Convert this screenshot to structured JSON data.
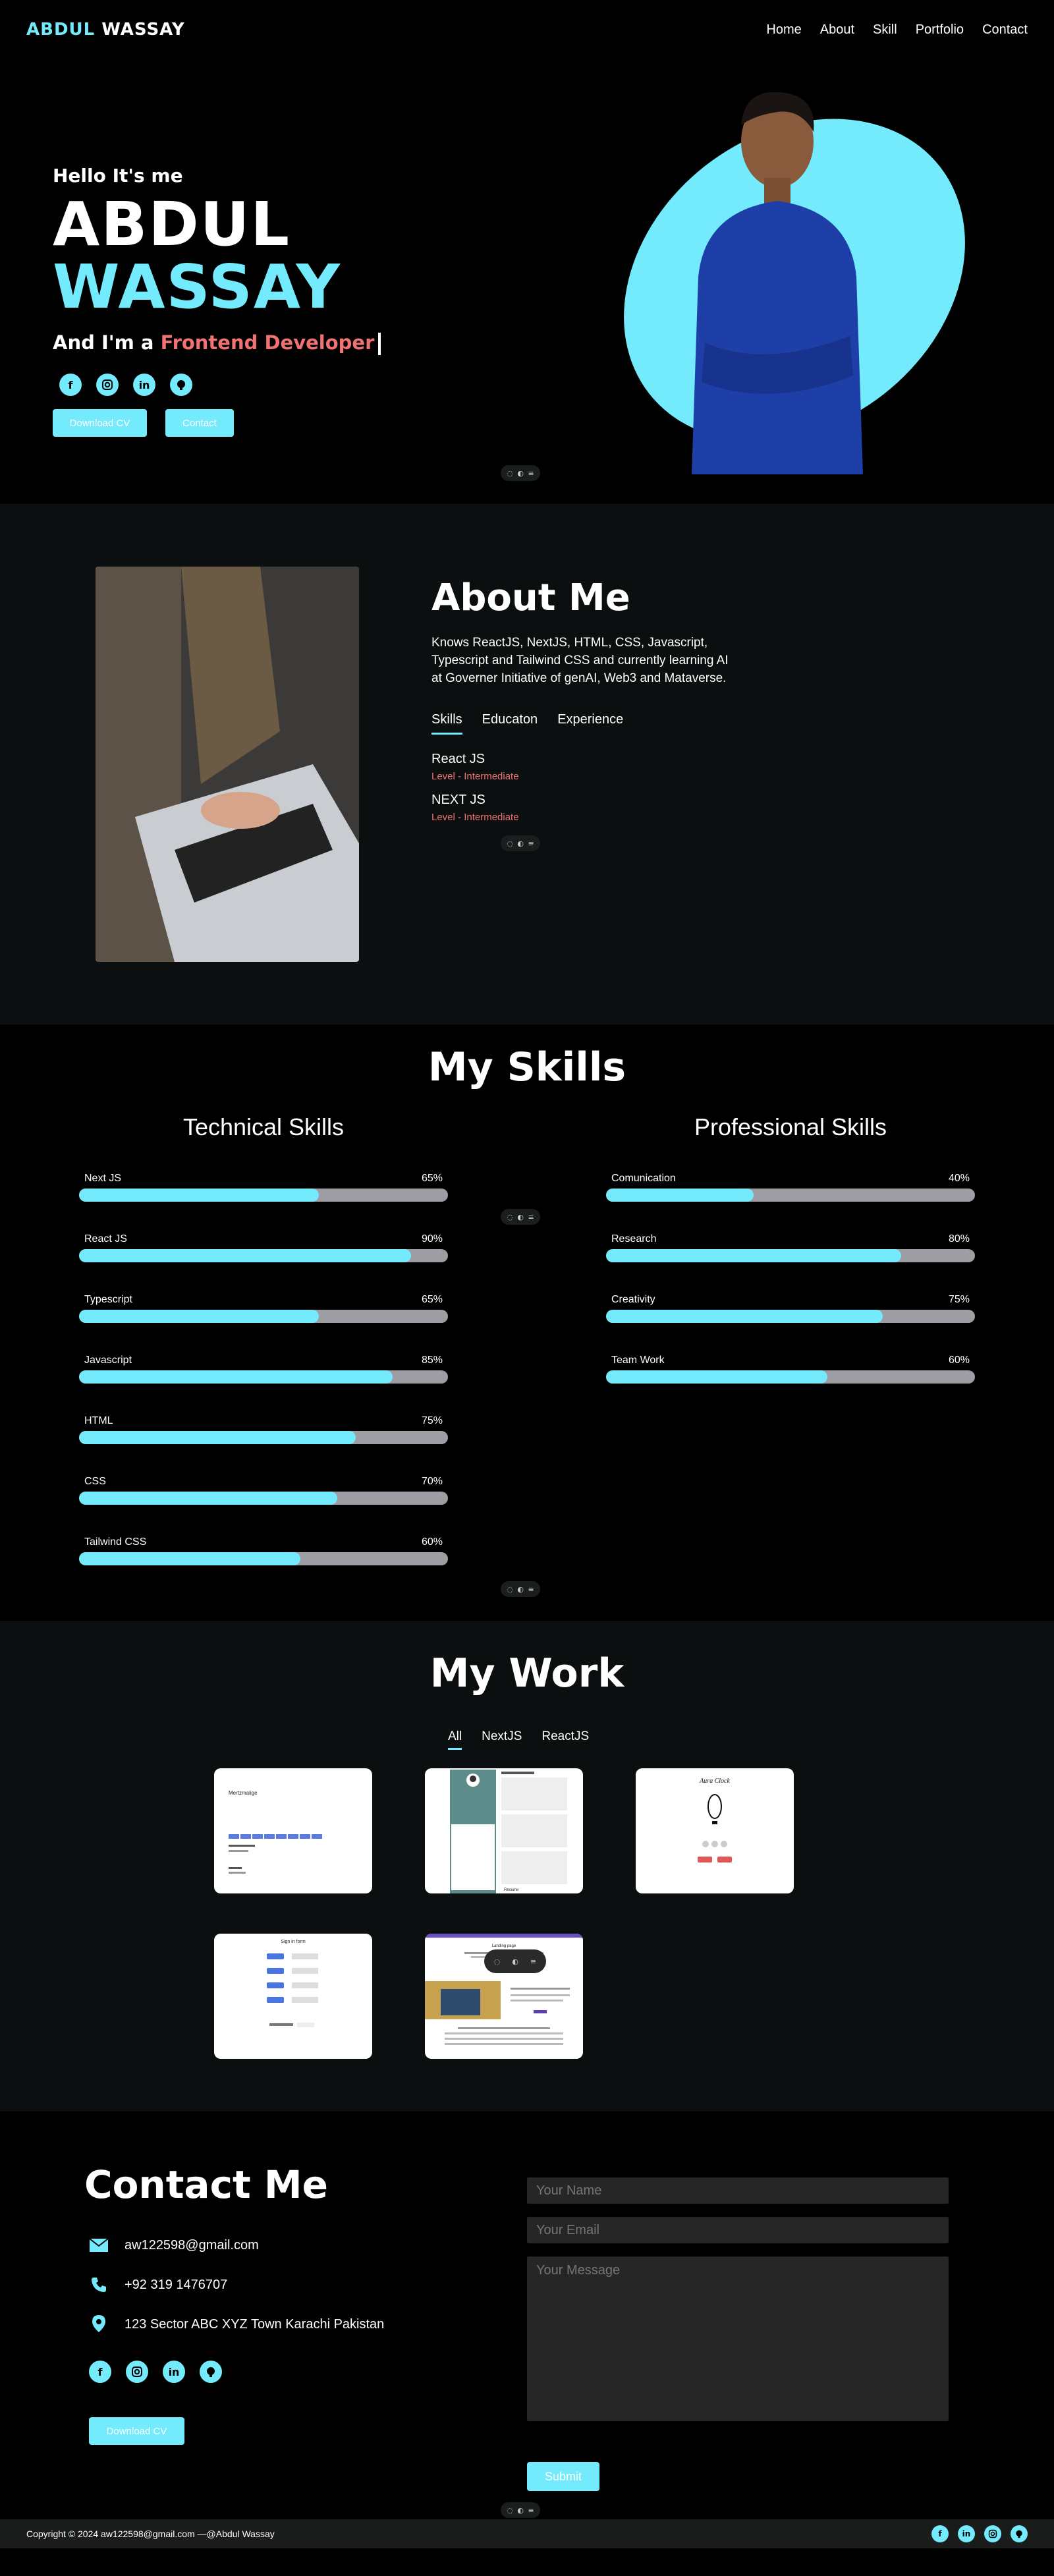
{
  "nav": {
    "logo_first": "ABDUL",
    "logo_last": "WASSAY",
    "links": [
      "Home",
      "About",
      "Skill",
      "Portfolio",
      "Contact"
    ]
  },
  "hero": {
    "greeting": "Hello It's me",
    "first_name": "ABDUL",
    "last_name": "WASSAY",
    "role_prefix": "And I'm a",
    "role": "Frontend Developer",
    "socials": [
      "facebook-icon",
      "instagram-icon",
      "linkedin-icon",
      "github-icon"
    ],
    "btn_cv": "Download CV",
    "btn_contact": "Contact"
  },
  "about": {
    "title": "About Me",
    "text": "Knows ReactJS, NextJS, HTML, CSS, Javascript, Typescript and Tailwind CSS and currently learning AI at Governer Initiative of genAI, Web3 and Mataverse.",
    "tabs": [
      "Skills",
      "Educaton",
      "Experience"
    ],
    "skills": [
      {
        "name": "React JS",
        "level": "Level - Intermediate"
      },
      {
        "name": "NEXT JS",
        "level": "Level - Intermediate"
      }
    ]
  },
  "skills": {
    "title": "My Skills",
    "technical_title": "Technical Skills",
    "professional_title": "Professional Skills",
    "technical": [
      {
        "name": "Next JS",
        "pct_label": "65%",
        "value": 65
      },
      {
        "name": "React JS",
        "pct_label": "90%",
        "value": 90
      },
      {
        "name": "Typescript",
        "pct_label": "65%",
        "value": 65
      },
      {
        "name": "Javascript",
        "pct_label": "85%",
        "value": 85
      },
      {
        "name": "HTML",
        "pct_label": "75%",
        "value": 75
      },
      {
        "name": "CSS",
        "pct_label": "70%",
        "value": 70
      },
      {
        "name": "Tailwind CSS",
        "pct_label": "60%",
        "value": 60
      }
    ],
    "professional": [
      {
        "name": "Comunication",
        "pct_label": "40%",
        "value": 40
      },
      {
        "name": "Research",
        "pct_label": "80%",
        "value": 80
      },
      {
        "name": "Creativity",
        "pct_label": "75%",
        "value": 75
      },
      {
        "name": "Team Work",
        "pct_label": "60%",
        "value": 60
      }
    ]
  },
  "work": {
    "title": "My Work",
    "filters": [
      "All",
      "NextJS",
      "ReactJS"
    ],
    "projects": [
      {
        "label": "Mertzmalige"
      },
      {
        "label": "Resume"
      },
      {
        "label": "Aura Clock"
      },
      {
        "label": "Sign in form"
      },
      {
        "label": "Landing page"
      }
    ]
  },
  "contact": {
    "title": "Contact Me",
    "email": "aw122598@gmail.com",
    "phone": "+92 319 1476707",
    "address": "123 Sector ABC XYZ Town Karachi Pakistan",
    "btn_cv": "Download CV",
    "placeholder_name": "Your Name",
    "placeholder_email": "Your Email",
    "placeholder_message": "Your Message",
    "btn_submit": "Submit"
  },
  "footer": {
    "copyright": "Copyright © 2024 aw122598@gmail.com —@Abdul Wassay"
  },
  "toolbar_icons": [
    "comment-icon",
    "sparkle-icon",
    "menu-icon"
  ],
  "colors": {
    "accent": "#73ebfd",
    "highlight": "#f07272",
    "background": "#000000",
    "section_dark": "#0c0f0f"
  }
}
